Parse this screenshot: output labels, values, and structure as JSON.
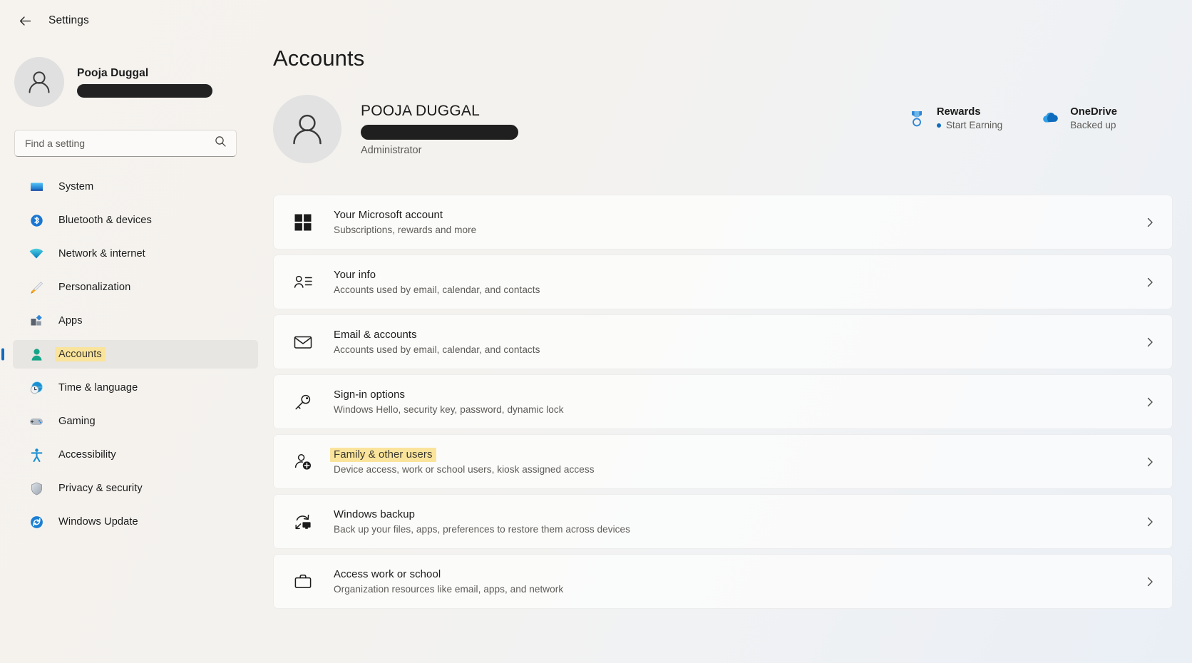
{
  "window": {
    "title": "Settings",
    "back_icon": "back-arrow-icon"
  },
  "sidebar": {
    "account": {
      "name": "Pooja Duggal",
      "email_redacted": true,
      "avatar_icon": "person-avatar-icon"
    },
    "search": {
      "placeholder": "Find a setting",
      "value": "",
      "icon": "search-icon"
    },
    "items": [
      {
        "label": "System",
        "icon": "monitor-icon",
        "selected": false,
        "highlighted": false
      },
      {
        "label": "Bluetooth & devices",
        "icon": "bluetooth-icon",
        "selected": false,
        "highlighted": false
      },
      {
        "label": "Network & internet",
        "icon": "wifi-icon",
        "selected": false,
        "highlighted": false
      },
      {
        "label": "Personalization",
        "icon": "paintbrush-icon",
        "selected": false,
        "highlighted": false
      },
      {
        "label": "Apps",
        "icon": "apps-icon",
        "selected": false,
        "highlighted": false
      },
      {
        "label": "Accounts",
        "icon": "person-icon",
        "selected": true,
        "highlighted": true
      },
      {
        "label": "Time & language",
        "icon": "clock-globe-icon",
        "selected": false,
        "highlighted": false
      },
      {
        "label": "Gaming",
        "icon": "gamepad-icon",
        "selected": false,
        "highlighted": false
      },
      {
        "label": "Accessibility",
        "icon": "accessibility-icon",
        "selected": false,
        "highlighted": false
      },
      {
        "label": "Privacy & security",
        "icon": "shield-icon",
        "selected": false,
        "highlighted": false
      },
      {
        "label": "Windows Update",
        "icon": "update-icon",
        "selected": false,
        "highlighted": false
      }
    ]
  },
  "main": {
    "page_title": "Accounts",
    "profile": {
      "name": "POOJA DUGGAL",
      "email_redacted": true,
      "role": "Administrator",
      "avatar_icon": "person-avatar-icon"
    },
    "widgets": [
      {
        "title": "Rewards",
        "status": "Start Earning",
        "icon": "rewards-medal-icon",
        "has_dot": true
      },
      {
        "title": "OneDrive",
        "status": "Backed up",
        "icon": "onedrive-cloud-icon",
        "has_dot": false
      }
    ],
    "cards": [
      {
        "title": "Your Microsoft account",
        "subtitle": "Subscriptions, rewards and more",
        "icon": "microsoft-logo-icon",
        "highlighted": false,
        "chevron": "chevron-right-icon"
      },
      {
        "title": "Your info",
        "subtitle": "Accounts used by email, calendar, and contacts",
        "icon": "person-details-icon",
        "highlighted": false,
        "chevron": "chevron-right-icon"
      },
      {
        "title": "Email & accounts",
        "subtitle": "Accounts used by email, calendar, and contacts",
        "icon": "envelope-icon",
        "highlighted": false,
        "chevron": "chevron-right-icon"
      },
      {
        "title": "Sign-in options",
        "subtitle": "Windows Hello, security key, password, dynamic lock",
        "icon": "key-icon",
        "highlighted": false,
        "chevron": "chevron-right-icon"
      },
      {
        "title": "Family & other users",
        "subtitle": "Device access, work or school users, kiosk assigned access",
        "icon": "person-add-icon",
        "highlighted": true,
        "chevron": "chevron-right-icon"
      },
      {
        "title": "Windows backup",
        "subtitle": "Back up your files, apps, preferences to restore them across devices",
        "icon": "backup-sync-icon",
        "highlighted": false,
        "chevron": "chevron-right-icon"
      },
      {
        "title": "Access work or school",
        "subtitle": "Organization resources like email, apps, and network",
        "icon": "briefcase-icon",
        "highlighted": false,
        "chevron": "chevron-right-icon"
      }
    ]
  },
  "colors": {
    "accent": "#0f6cbd",
    "highlight": "#fae49b",
    "selected_nav_bg": "#e8e6e2",
    "card_bg": "#fdfdfd",
    "text_primary": "#1b1b1b",
    "text_secondary": "#5d5b57"
  }
}
